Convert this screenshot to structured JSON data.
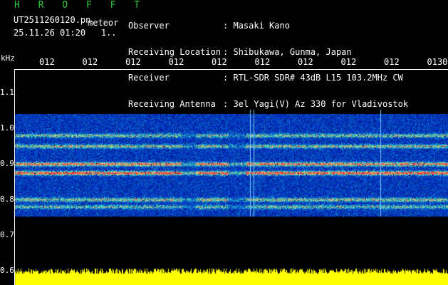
{
  "header": {
    "brand": "H R O F F T",
    "filename": "UT2511260120.pn",
    "filename_suffix": "meteor",
    "datetime": "25.11.26 01:20",
    "page_marker": "1..",
    "info": [
      {
        "label": "Observer",
        "value": ": Masaki Kano"
      },
      {
        "label": "Receiving Location",
        "value": ": Shibukawa, Gunma, Japan"
      },
      {
        "label": "Receiver",
        "value": ": RTL-SDR SDR# 43dB L15 103.2MHz CW"
      },
      {
        "label": "Receiving Antenna",
        "value": ": 3el Yagi(V) Az 330 for Vladivostok"
      }
    ]
  },
  "chart_data": {
    "type": "heatmap",
    "ylabel": "kHz",
    "y_ticks": [
      "1.1",
      "1.0",
      "0.9",
      "0.8",
      "0.7",
      "0.6"
    ],
    "ylim": [
      0.6,
      1.1
    ],
    "x_ticks": [
      "012",
      "012",
      "012",
      "012",
      "012",
      "012",
      "012",
      "012",
      "012",
      "0130"
    ],
    "bands": [
      {
        "freq": 0.98,
        "strength": 0.55
      },
      {
        "freq": 0.95,
        "strength": 0.6
      },
      {
        "freq": 0.9,
        "strength": 0.85
      },
      {
        "freq": 0.875,
        "strength": 0.95
      },
      {
        "freq": 0.8,
        "strength": 0.6
      },
      {
        "freq": 0.78,
        "strength": 0.5
      }
    ],
    "noise_floor_color": "#1030b0",
    "peak_color": "#ff3030",
    "power_trace_color": "#ffff00"
  }
}
